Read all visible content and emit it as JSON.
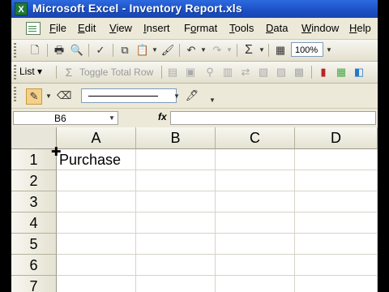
{
  "window": {
    "title": "Microsoft Excel - Inventory Report.xls",
    "app_icon_glyph": "X"
  },
  "menu": {
    "items": [
      {
        "label": "File",
        "accel": "F",
        "rest": "ile"
      },
      {
        "label": "Edit",
        "accel": "E",
        "rest": "dit"
      },
      {
        "label": "View",
        "accel": "V",
        "rest": "iew"
      },
      {
        "label": "Insert",
        "accel": "I",
        "rest": "nsert"
      },
      {
        "label": "Format",
        "accel": "o",
        "pre": "F",
        "rest": "rmat"
      },
      {
        "label": "Tools",
        "accel": "T",
        "rest": "ools"
      },
      {
        "label": "Data",
        "accel": "D",
        "rest": "ata"
      },
      {
        "label": "Window",
        "accel": "W",
        "rest": "indow"
      },
      {
        "label": "Help",
        "accel": "H",
        "rest": "elp"
      }
    ]
  },
  "standard_toolbar": {
    "zoom": "100%",
    "sum_glyph": "Σ"
  },
  "list_toolbar": {
    "list_label": "List",
    "toggle_total_row": "Toggle Total Row",
    "sigma_glyph": "Σ"
  },
  "formula_bar": {
    "name_box": "B6",
    "fx": "fx",
    "formula": ""
  },
  "sheet": {
    "columns": [
      "A",
      "B",
      "C",
      "D"
    ],
    "rows": [
      "1",
      "2",
      "3",
      "4",
      "5",
      "6",
      "7"
    ],
    "cells": {
      "A1": "Purchase"
    }
  },
  "colors": {
    "titlebar": "#1c4fc4",
    "toolbar": "#ece9d8",
    "grid_lines": "#d6d3c8"
  }
}
